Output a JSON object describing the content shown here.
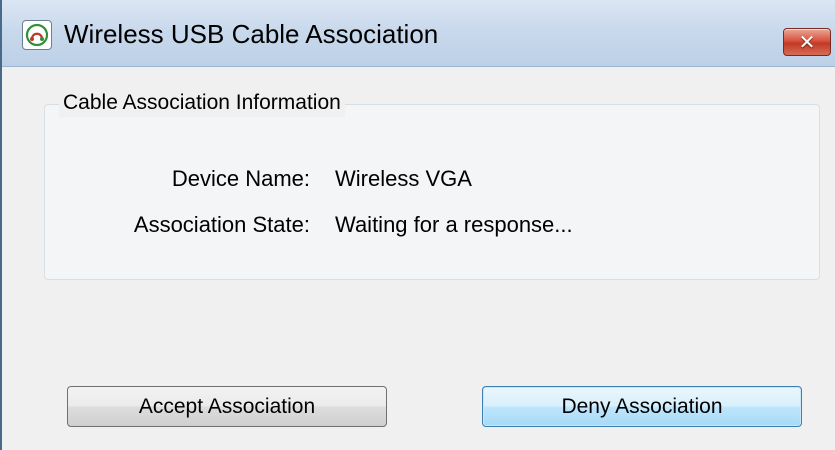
{
  "window": {
    "title": "Wireless USB Cable Association",
    "app_icon": "wireless-usb-icon",
    "close_glyph": "✕",
    "close_icon": "close-icon"
  },
  "group": {
    "legend": "Cable Association Information",
    "fields": [
      {
        "label": "Device Name:",
        "value": "Wireless VGA"
      },
      {
        "label": "Association State:",
        "value": "Waiting for a response..."
      }
    ]
  },
  "buttons": {
    "accept_label": "Accept Association",
    "deny_label": "Deny Association"
  },
  "colors": {
    "titlebar": "#c9d9ec",
    "close_button": "#d9533e",
    "focused_button_border": "#3c7fb1"
  }
}
